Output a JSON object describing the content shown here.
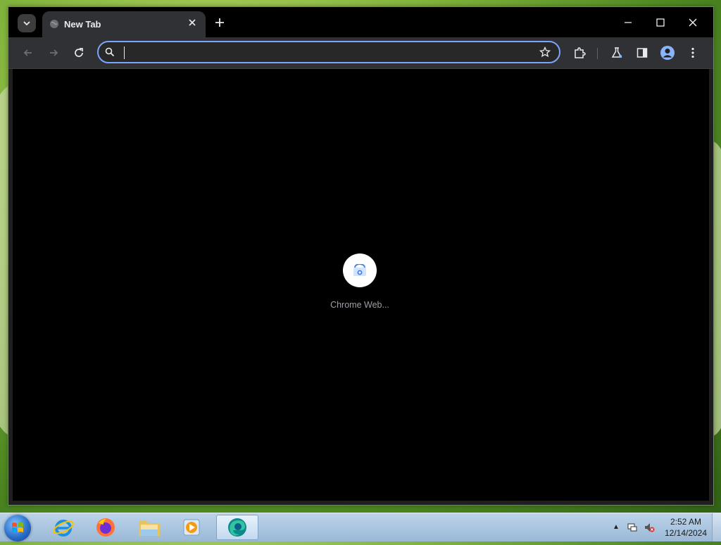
{
  "browser": {
    "tab": {
      "title": "New Tab"
    },
    "omnibox": {
      "value": "",
      "placeholder": ""
    },
    "shortcut": {
      "label": "Chrome Web..."
    }
  },
  "taskbar": {
    "apps": [
      "internet-explorer",
      "firefox",
      "file-explorer",
      "media-player",
      "edge"
    ],
    "clock": {
      "time": "2:52 AM",
      "date": "12/14/2024"
    }
  },
  "colors": {
    "omnibox_focus": "#7ba4ff",
    "toolbar": "#303134",
    "titlebar": "#000000",
    "content": "#000000"
  }
}
